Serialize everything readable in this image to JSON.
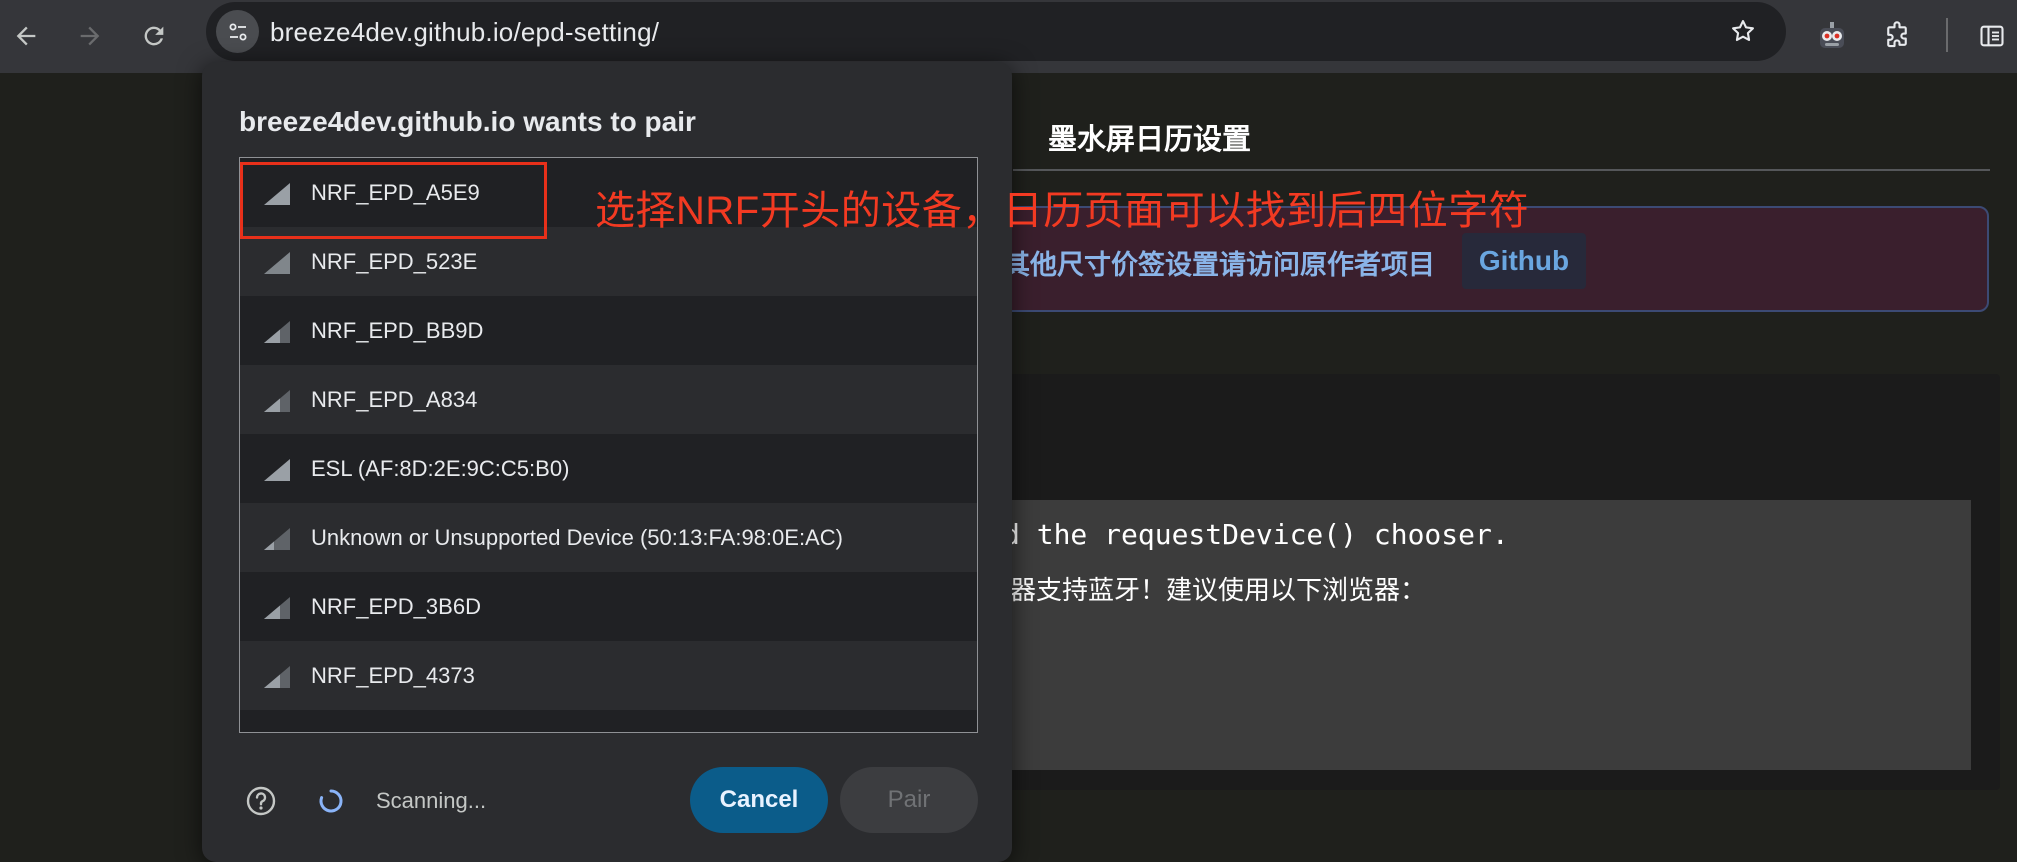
{
  "browser": {
    "url": "breeze4dev.github.io/epd-setting/"
  },
  "page": {
    "title": "墨水屏日历设置",
    "notice_text": "其他尺寸价签设置请访问原作者项目",
    "notice_link": "Github",
    "console_line1": "d the requestDevice() chooser.",
    "console_line2": "器支持蓝牙！建议使用以下浏览器："
  },
  "dialog": {
    "title": "breeze4dev.github.io wants to pair",
    "devices": [
      {
        "name": "NRF_EPD_A5E9"
      },
      {
        "name": "NRF_EPD_523E"
      },
      {
        "name": "NRF_EPD_BB9D"
      },
      {
        "name": "NRF_EPD_A834"
      },
      {
        "name": "ESL (AF:8D:2E:9C:C5:B0)"
      },
      {
        "name": "Unknown or Unsupported Device (50:13:FA:98:0E:AC)"
      },
      {
        "name": "NRF_EPD_3B6D"
      },
      {
        "name": "NRF_EPD_4373"
      }
    ],
    "status": "Scanning...",
    "cancel_label": "Cancel",
    "pair_label": "Pair"
  },
  "annotation": {
    "text": "选择NRF开头的设备，日历页面可以找到后四位字符",
    "color": "#f33a22"
  },
  "icons": {
    "back": "back-arrow-icon",
    "forward": "forward-arrow-icon",
    "reload": "reload-icon",
    "site_info": "tune-icon",
    "bookmark": "star-icon",
    "extension_avatar": "robot-icon",
    "extensions": "puzzle-icon",
    "side_panel": "side-panel-icon",
    "signal": "signal-strength-icon",
    "help": "help-icon",
    "spinner": "spinner-icon"
  }
}
